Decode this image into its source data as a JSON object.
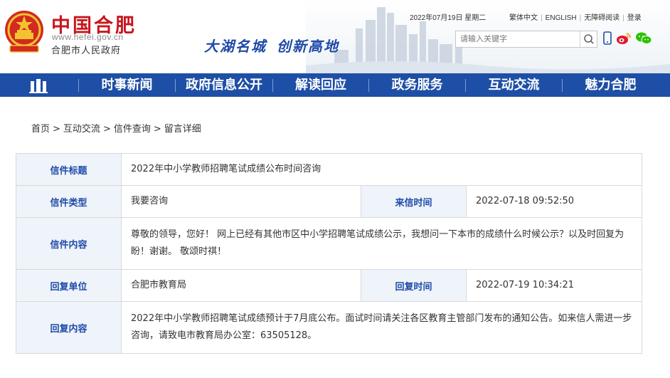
{
  "header": {
    "logo_cn": "中国合肥",
    "logo_url": "www.hefei.gov.cn",
    "logo_sub": "合肥市人民政府",
    "slogan": [
      "大湖名城",
      "创新高地"
    ],
    "date": "2022年07月19日 星期二",
    "links": [
      "繁体中文",
      "ENGLISH",
      "无障碍阅读",
      "登录"
    ],
    "search_placeholder": "请输入关键字"
  },
  "nav": {
    "items": [
      "时事新闻",
      "政府信息公开",
      "解读回应",
      "政务服务",
      "互动交流",
      "魅力合肥"
    ]
  },
  "breadcrumb": [
    "首页",
    "互动交流",
    "信件查询",
    "留言详细"
  ],
  "letter": {
    "title_label": "信件标题",
    "title": "2022年中小学教师招聘笔试成绩公布时间咨询",
    "type_label": "信件类型",
    "type": "我要咨询",
    "time_label": "来信时间",
    "time": "2022-07-18 09:52:50",
    "content_label": "信件内容",
    "content": "尊敬的领导，您好！ 网上已经有其他市区中小学招聘笔试成绩公示，我想问一下本市的成绩什么时候公示？以及时回复为盼！谢谢。 敬颂时祺！",
    "reply_unit_label": "回复单位",
    "reply_unit": "合肥市教育局",
    "reply_time_label": "回复时间",
    "reply_time": "2022-07-19 10:34:21",
    "reply_content_label": "回复内容",
    "reply_content": "2022年中小学教师招聘笔试成绩预计于7月底公布。面试时间请关注各区教育主管部门发布的通知公告。如来信人需进一步咨询，请致电市教育局办公室：63505128。"
  },
  "colors": {
    "brand_red": "#c8161d",
    "nav_blue": "#1e4fa6",
    "label_bg": "#eff4fb",
    "label_text": "#1f4aa8"
  }
}
